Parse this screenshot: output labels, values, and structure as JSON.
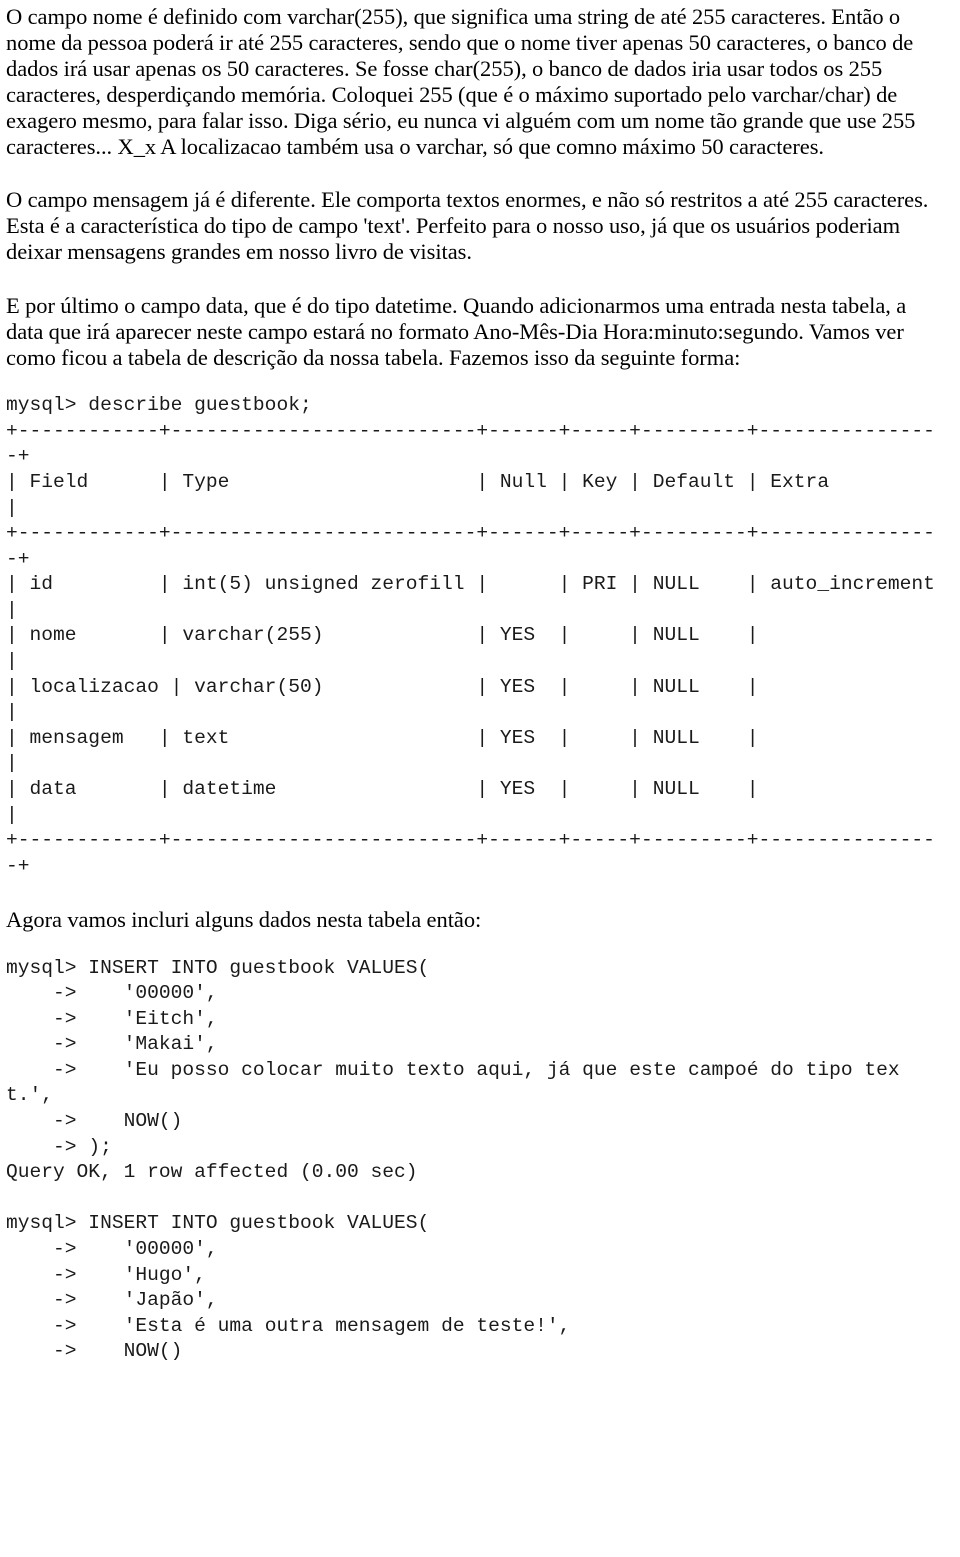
{
  "document": {
    "type": "tutorial-page",
    "language": "pt-BR",
    "topic": "MySQL guestbook table",
    "background_color": "#ffffff",
    "text_color": "#000000"
  },
  "body": {
    "paragraph_1": "O campo nome é definido com varchar(255), que significa uma string de até 255 caracteres. Então o nome da pessoa poderá ir até 255 caracteres, sendo que o nome tiver apenas 50 caracteres, o banco de dados irá usar apenas os 50 caracteres. Se fosse char(255), o banco de dados iria usar todos os 255 caracteres, desperdiçando memória. Coloquei 255 (que é o máximo suportado pelo varchar/char) de exagero mesmo, para falar isso. Diga sério, eu nunca vi alguém com um nome tão grande que use 255 caracteres... X_x A localizacao também usa o varchar, só que comno máximo 50 caracteres.",
    "paragraph_2": "O campo mensagem já é diferente. Ele comporta textos enormes, e não só restritos a até 255 caracteres. Esta é a característica do tipo de campo 'text'. Perfeito para o nosso uso, já que os usuários poderiam deixar mensagens grandes em nosso livro de visitas.",
    "paragraph_3": "E por último o campo data, que é do tipo datetime. Quando adicionarmos uma entrada nesta tabela, a data que irá aparecer neste campo estará no formato Ano-Mês-Dia Hora:minuto:segundo. Vamos ver como ficou a tabela de descrição da nossa tabela. Fazemos isso da seguinte forma:",
    "paragraph_4": "Agora vamos incluri alguns dados nesta tabela então:"
  },
  "code_block_describe": {
    "prompt": "mysql>",
    "command": "describe guestbook;",
    "separator": "+------------+--------------------------+------+-----+---------+----------------+",
    "columns": [
      "Field",
      "Type",
      "Null",
      "Key",
      "Default",
      "Extra"
    ],
    "rows": [
      {
        "field": "id",
        "type": "int(5) unsigned zerofill",
        "null": "",
        "key": "PRI",
        "default": "NULL",
        "extra": "auto_increment"
      },
      {
        "field": "nome",
        "type": "varchar(255)",
        "null": "YES",
        "key": "",
        "default": "NULL",
        "extra": ""
      },
      {
        "field": "localizacao",
        "type": "varchar(50)",
        "null": "YES",
        "key": "",
        "default": "NULL",
        "extra": ""
      },
      {
        "field": "mensagem",
        "type": "text",
        "null": "YES",
        "key": "",
        "default": "NULL",
        "extra": ""
      },
      {
        "field": "data",
        "type": "datetime",
        "null": "YES",
        "key": "",
        "default": "NULL",
        "extra": ""
      }
    ],
    "text": "mysql> describe guestbook;\n+------------+--------------------------+------+-----+---------+----------------+\n| Field      | Type                     | Null | Key | Default | Extra          |\n+------------+--------------------------+------+-----+---------+----------------+\n| id         | int(5) unsigned zerofill |      | PRI | NULL    | auto_increment |\n| nome       | varchar(255)             | YES  |     | NULL    |                |\n| localizacao | varchar(50)             | YES  |     | NULL    |                |\n| mensagem   | text                     | YES  |     | NULL    |                |\n| data       | datetime                 | YES  |     | NULL    |                |\n+------------+--------------------------+------+-----+---------+----------------+"
  },
  "code_block_inserts": {
    "text": "mysql> INSERT INTO guestbook VALUES(\n    ->    '00000',\n    ->    'Eitch',\n    ->    'Makai',\n    ->    'Eu posso colocar muito texto aqui, já que este campoé do tipo text.',\n    ->    NOW()\n    -> );\nQuery OK, 1 row affected (0.00 sec)\n\nmysql> INSERT INTO guestbook VALUES(\n    ->    '00000',\n    ->    'Hugo',\n    ->    'Japão',\n    ->    'Esta é uma outra mensagem de teste!',\n    ->    NOW()",
    "statement_1": {
      "prompt": "mysql>",
      "command": "INSERT INTO guestbook VALUES(",
      "continuation_prompt": "->",
      "values": [
        "'00000',",
        "'Eitch',",
        "'Makai',",
        "'Eu posso colocar muito texto aqui, já que este campoé do tipo text.',",
        "NOW()",
        ");"
      ],
      "result": "Query OK, 1 row affected (0.00 sec)"
    },
    "statement_2": {
      "prompt": "mysql>",
      "command": "INSERT INTO guestbook VALUES(",
      "continuation_prompt": "->",
      "values": [
        "'00000',",
        "'Hugo',",
        "'Japão',",
        "'Esta é uma outra mensagem de teste!',",
        "NOW()"
      ]
    }
  }
}
